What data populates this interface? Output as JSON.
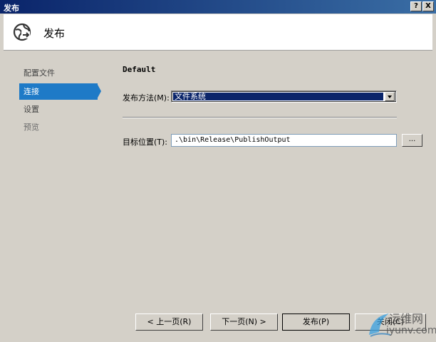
{
  "window": {
    "title": "发布",
    "help_btn": "?",
    "close_btn": "X"
  },
  "header": {
    "title": "发布",
    "icon": "globe-publish-icon"
  },
  "nav": {
    "items": [
      {
        "label": "配置文件",
        "state": "normal"
      },
      {
        "label": "连接",
        "state": "active"
      },
      {
        "label": "设置",
        "state": "normal"
      },
      {
        "label": "预览",
        "state": "disabled"
      }
    ]
  },
  "main": {
    "profile_name": "Default",
    "publish_method_label": "发布方法(M):",
    "publish_method_value": "文件系统",
    "target_location_label": "目标位置(T):",
    "target_location_value": ".\\bin\\Release\\PublishOutput",
    "browse_label": "..."
  },
  "buttons": {
    "prev": "< 上一页(R)",
    "next": "下一页(N) >",
    "publish": "发布(P)",
    "close": "关闭(C)"
  },
  "watermark": {
    "line1": "运维网",
    "line2": "iyunv.com"
  },
  "colors": {
    "dialog_bg": "#d4d0c8",
    "titlebar": "#0a246a",
    "nav_active": "#1e7ac7",
    "selection": "#0a246a"
  }
}
